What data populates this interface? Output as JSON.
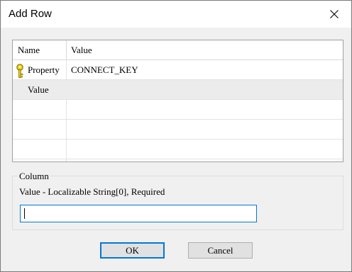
{
  "window": {
    "title": "Add Row"
  },
  "grid": {
    "headers": {
      "name": "Name",
      "value": "Value"
    },
    "rows": [
      {
        "name": "Property",
        "value": "CONNECT_KEY",
        "icon": "key-icon"
      },
      {
        "name": "Value",
        "value": ""
      }
    ]
  },
  "column_group": {
    "label": "Column",
    "description": "Value - Localizable String[0], Required",
    "input_value": ""
  },
  "buttons": {
    "ok": "OK",
    "cancel": "Cancel"
  },
  "colors": {
    "accent": "#0078d7",
    "key": "#e8c400"
  }
}
